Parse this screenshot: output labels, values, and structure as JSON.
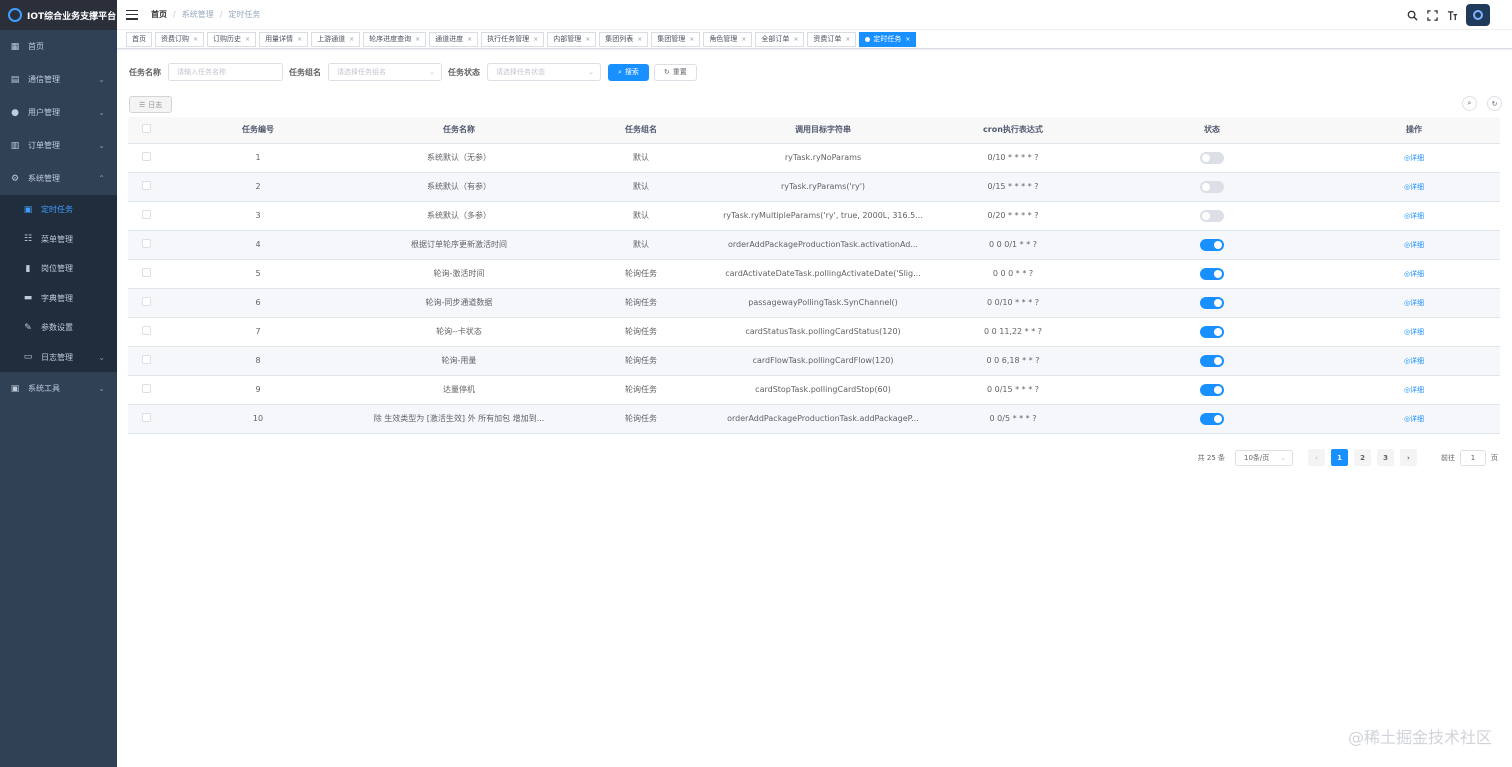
{
  "app": {
    "title": "IOT综合业务支撑平台"
  },
  "sidebar": {
    "items": [
      {
        "label": "首页",
        "icon": "dashboard-icon"
      },
      {
        "label": "通信管理",
        "icon": "message-icon",
        "arrow": "⌄"
      },
      {
        "label": "用户管理",
        "icon": "user-icon",
        "arrow": "⌄"
      },
      {
        "label": "订单管理",
        "icon": "chart-icon",
        "arrow": "⌄"
      },
      {
        "label": "系统管理",
        "icon": "gear-icon",
        "arrow": "⌃"
      }
    ],
    "submenu": [
      {
        "label": "定时任务",
        "icon": "job-icon",
        "active": true
      },
      {
        "label": "菜单管理",
        "icon": "tree-table-icon"
      },
      {
        "label": "岗位管理",
        "icon": "post-icon"
      },
      {
        "label": "字典管理",
        "icon": "dict-icon"
      },
      {
        "label": "参数设置",
        "icon": "edit-icon"
      },
      {
        "label": "日志管理",
        "icon": "log-icon",
        "arrow": "⌄"
      }
    ],
    "tools": {
      "label": "系统工具",
      "icon": "tool-icon",
      "arrow": "⌄"
    }
  },
  "breadcrumb": {
    "home": "首页",
    "sep": "/",
    "level1": "系统管理",
    "current": "定时任务"
  },
  "tags": [
    {
      "label": "首页"
    },
    {
      "label": "资费订购"
    },
    {
      "label": "订购历史"
    },
    {
      "label": "用量详情"
    },
    {
      "label": "上游通道"
    },
    {
      "label": "轮序进度查询"
    },
    {
      "label": "通道进度"
    },
    {
      "label": "执行任务管理"
    },
    {
      "label": "内部管理"
    },
    {
      "label": "集团列表"
    },
    {
      "label": "集团管理"
    },
    {
      "label": "角色管理"
    },
    {
      "label": "全部订单"
    },
    {
      "label": "资费订单"
    },
    {
      "label": "定时任务",
      "active": true
    }
  ],
  "search": {
    "name_label": "任务名称",
    "name_placeholder": "请输入任务名称",
    "group_label": "任务组名",
    "group_placeholder": "请选择任务组名",
    "status_label": "任务状态",
    "status_placeholder": "请选择任务状态",
    "search_btn": "搜索",
    "reset_btn": "重置"
  },
  "toolbar": {
    "log_btn": "日志"
  },
  "table": {
    "headers": [
      "任务编号",
      "任务名称",
      "任务组名",
      "调用目标字符串",
      "cron执行表达式",
      "状态",
      "操作"
    ],
    "action_label": "详细",
    "rows": [
      {
        "id": "1",
        "name": "系统默认（无参）",
        "group": "默认",
        "target": "ryTask.ryNoParams",
        "cron": "0/10 * * * * ?",
        "status": false
      },
      {
        "id": "2",
        "name": "系统默认（有参）",
        "group": "默认",
        "target": "ryTask.ryParams('ry')",
        "cron": "0/15 * * * * ?",
        "status": false
      },
      {
        "id": "3",
        "name": "系统默认（多参）",
        "group": "默认",
        "target": "ryTask.ryMultipleParams('ry', true, 2000L, 316.5...",
        "cron": "0/20 * * * * ?",
        "status": false
      },
      {
        "id": "4",
        "name": "根据订单轮序更新激活时间",
        "group": "默认",
        "target": "orderAddPackageProductionTask.activationAd...",
        "cron": "0 0 0/1 * * ?",
        "status": true
      },
      {
        "id": "5",
        "name": "轮询-激活时间",
        "group": "轮询任务",
        "target": "cardActivateDateTask.pollingActivateDate('Slig...",
        "cron": "0 0 0 * * ?",
        "status": true
      },
      {
        "id": "6",
        "name": "轮询-同步通道数据",
        "group": "轮询任务",
        "target": "passagewayPollingTask.SynChannel()",
        "cron": "0 0/10 * * * ?",
        "status": true
      },
      {
        "id": "7",
        "name": "轮询--卡状态",
        "group": "轮询任务",
        "target": "cardStatusTask.pollingCardStatus(120)",
        "cron": "0 0 11,22 * * ?",
        "status": true
      },
      {
        "id": "8",
        "name": "轮询-用量",
        "group": "轮询任务",
        "target": "cardFlowTask.pollingCardFlow(120)",
        "cron": "0 0 6,18 * * ?",
        "status": true
      },
      {
        "id": "9",
        "name": "达量停机",
        "group": "轮询任务",
        "target": "cardStopTask.pollingCardStop(60)",
        "cron": "0 0/15 * * * ?",
        "status": true
      },
      {
        "id": "10",
        "name": "除 生效类型为 [激活生效] 外 所有加包 增加到...",
        "group": "轮询任务",
        "target": "orderAddPackageProductionTask.addPackageP...",
        "cron": "0 0/5 * * * ?",
        "status": true
      }
    ]
  },
  "pagination": {
    "total": "共 25 条",
    "page_size": "10条/页",
    "pages": [
      "1",
      "2",
      "3"
    ],
    "current": "1",
    "goto_label": "前往",
    "goto_value": "1",
    "goto_suffix": "页"
  },
  "watermark": "@稀土掘金技术社区"
}
